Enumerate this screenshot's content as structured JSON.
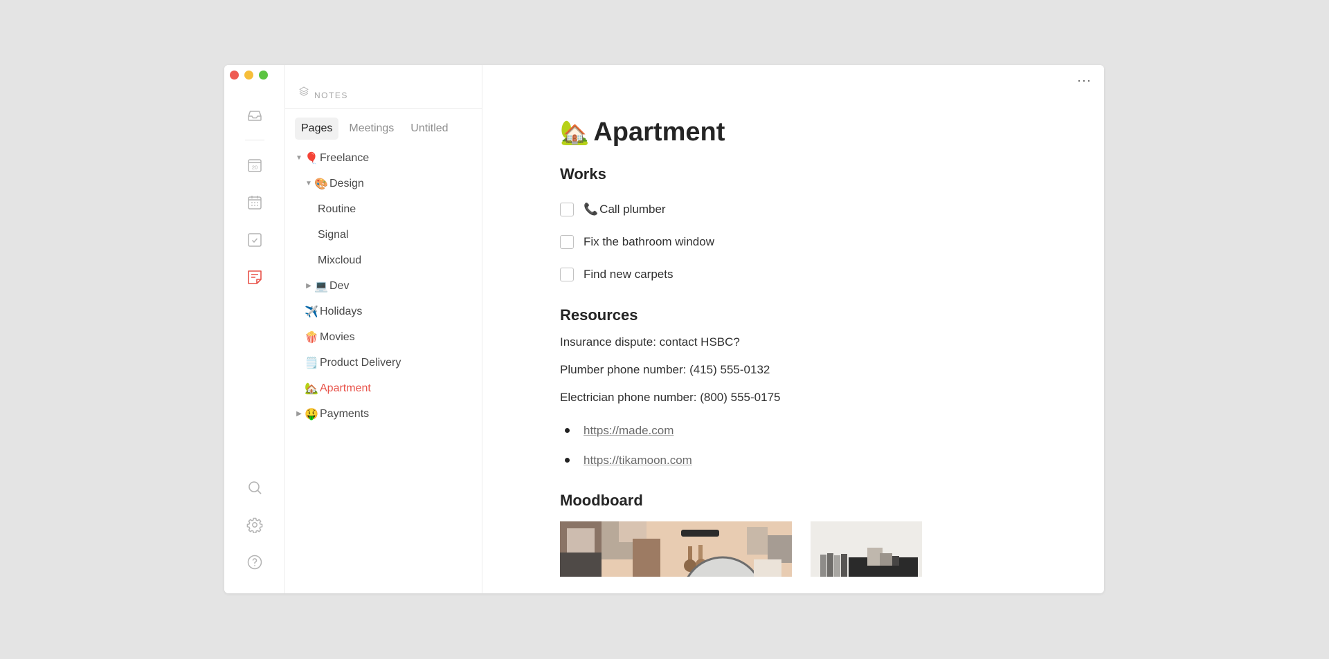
{
  "window": {
    "controls": [
      "close",
      "minimize",
      "maximize"
    ]
  },
  "rail": {
    "icons": [
      {
        "name": "inbox-icon"
      },
      {
        "name": "calendar-day-icon",
        "text": "20"
      },
      {
        "name": "calendar-grid-icon"
      },
      {
        "name": "tasks-check-icon"
      },
      {
        "name": "notes-icon",
        "active": true
      },
      {
        "name": "search-icon"
      },
      {
        "name": "settings-gear-icon"
      },
      {
        "name": "help-icon"
      }
    ],
    "calendar_day": "20"
  },
  "sidebar": {
    "header_label": "NOTES",
    "tabs": [
      "Pages",
      "Meetings",
      "Untitled"
    ],
    "active_tab": "Pages",
    "tree": [
      {
        "label": "Freelance",
        "emoji": "🎈",
        "caret": "▼",
        "level": 0
      },
      {
        "label": "Design",
        "emoji": "🎨",
        "caret": "▼",
        "level": 1
      },
      {
        "label": "Routine",
        "emoji": "",
        "caret": "",
        "level": 2
      },
      {
        "label": "Signal",
        "emoji": "",
        "caret": "",
        "level": 2
      },
      {
        "label": "Mixcloud",
        "emoji": "",
        "caret": "",
        "level": 2
      },
      {
        "label": "Dev",
        "emoji": "💻",
        "caret": "▶",
        "level": 1
      },
      {
        "label": "Holidays",
        "emoji": "✈️",
        "caret": "",
        "level": 0
      },
      {
        "label": "Movies",
        "emoji": "🍿",
        "caret": "",
        "level": 0
      },
      {
        "label": "Product Delivery",
        "emoji": "🗒️",
        "caret": "",
        "level": 0
      },
      {
        "label": "Apartment",
        "emoji": "🏡",
        "caret": "",
        "level": 0,
        "active": true
      },
      {
        "label": "Payments",
        "emoji": "🤑",
        "caret": "▶",
        "level": 0
      }
    ]
  },
  "main": {
    "more_label": "···",
    "title": "Apartment",
    "title_emoji": "🏡",
    "works": {
      "heading": "Works",
      "todos": [
        {
          "emoji": "📞",
          "text": "Call plumber",
          "checked": false
        },
        {
          "emoji": "",
          "text": "Fix the bathroom window",
          "checked": false
        },
        {
          "emoji": "",
          "text": "Find new carpets",
          "checked": false
        }
      ]
    },
    "resources": {
      "heading": "Resources",
      "lines": [
        "Insurance dispute: contact HSBC?",
        "Plumber phone number: (415) 555-0132",
        "Electrician phone number: (800) 555-0175"
      ],
      "links": [
        "https://made.com",
        "https://tikamoon.com"
      ]
    },
    "moodboard": {
      "heading": "Moodboard",
      "images": [
        "moodboard-image-1",
        "moodboard-image-2"
      ]
    }
  },
  "colors": {
    "accent": "#e8534a",
    "background": "#e4e4e4",
    "window": "#ffffff"
  }
}
